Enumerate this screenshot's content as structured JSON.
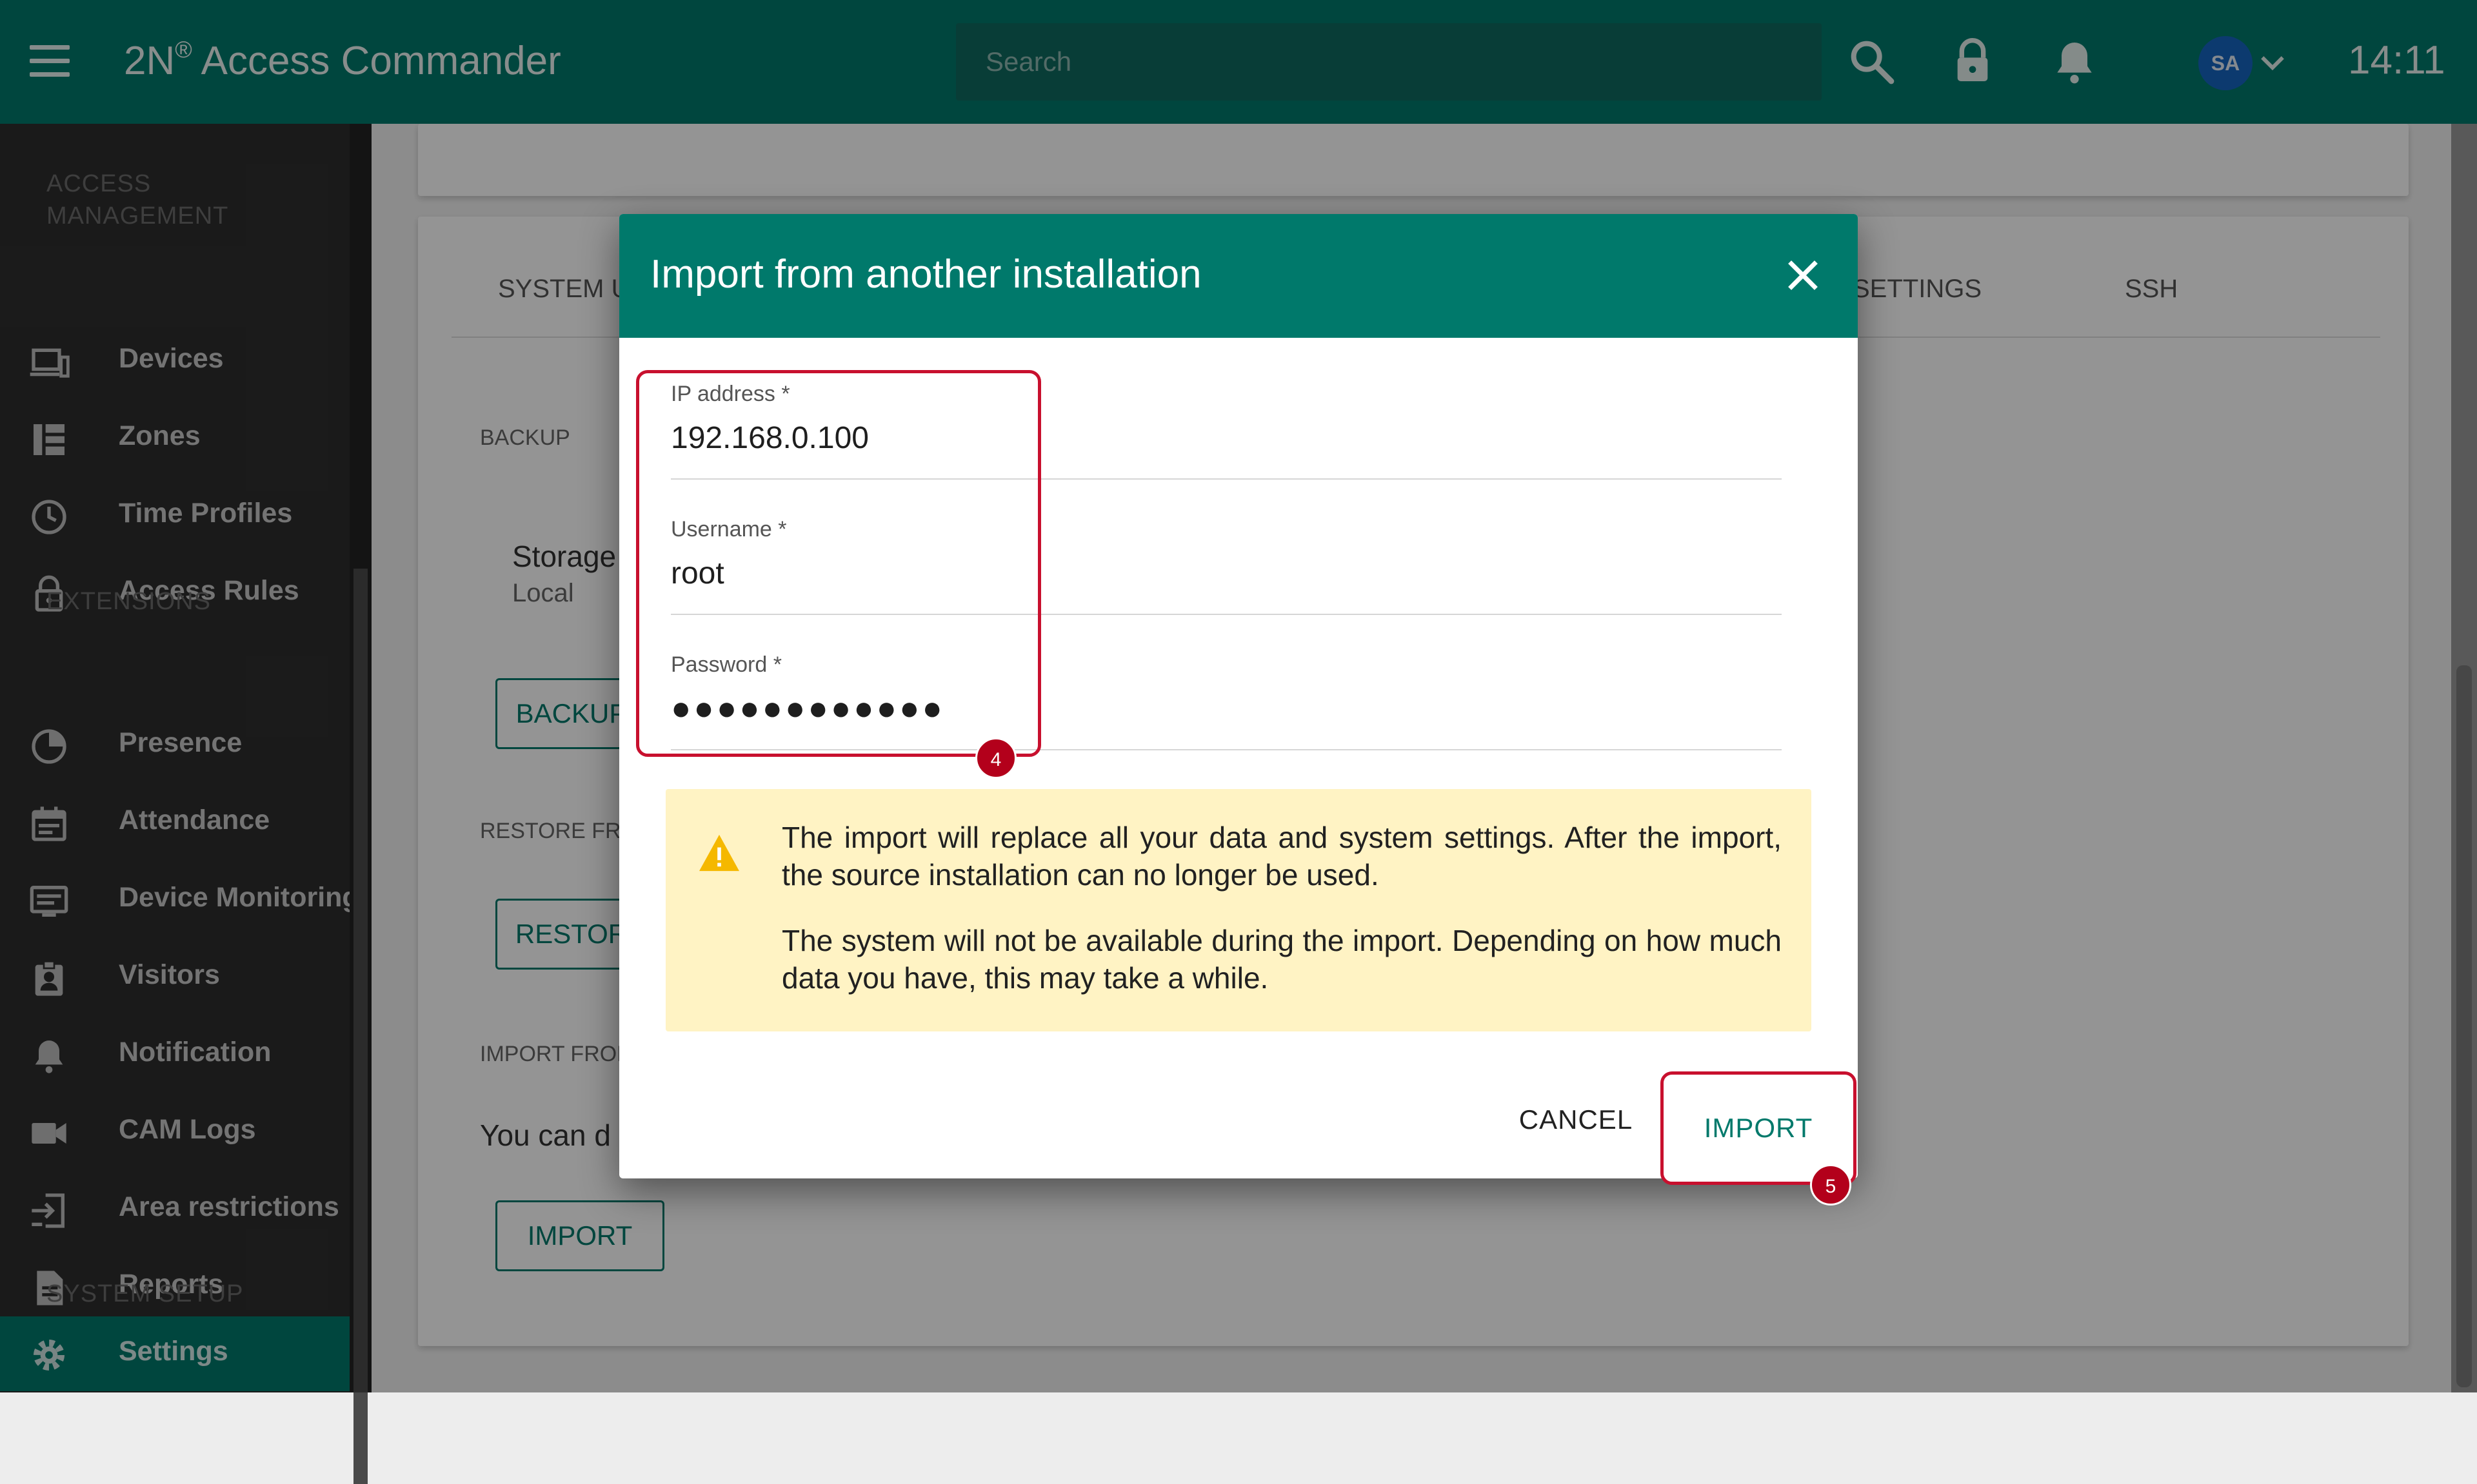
{
  "topbar": {
    "app_title": "2N",
    "app_title_sup": "®",
    "app_title_rest": " Access Commander",
    "search_placeholder": "Search",
    "avatar_initials": "SA",
    "time": "14:11",
    "icons": [
      "menu-icon",
      "search-icon",
      "lock-icon",
      "bell-icon",
      "chevron-down-icon"
    ]
  },
  "sidebar": {
    "sections": {
      "access_management_1": "ACCESS",
      "access_management_2": "MANAGEMENT",
      "extensions": "EXTENSIONS",
      "system_setup": "SYSTEM SETUP"
    },
    "items": [
      {
        "label": "Devices",
        "icon": "devices-icon"
      },
      {
        "label": "Zones",
        "icon": "zones-icon"
      },
      {
        "label": "Time Profiles",
        "icon": "clock-icon"
      },
      {
        "label": "Access Rules",
        "icon": "lock-icon"
      },
      {
        "label": "Presence",
        "icon": "presence-icon"
      },
      {
        "label": "Attendance",
        "icon": "calendar-icon"
      },
      {
        "label": "Device Monitoring",
        "icon": "monitor-icon"
      },
      {
        "label": "Visitors",
        "icon": "visitor-badge-icon"
      },
      {
        "label": "Notification",
        "icon": "bell-icon"
      },
      {
        "label": "CAM Logs",
        "icon": "camera-icon"
      },
      {
        "label": "Area restrictions",
        "icon": "area-icon"
      },
      {
        "label": "Reports",
        "icon": "report-icon"
      },
      {
        "label": "Settings",
        "icon": "gear-icon"
      }
    ]
  },
  "background": {
    "tab_system": "SYSTEM U",
    "tab_settings": "SETTINGS",
    "tab_ssh": "SSH",
    "backup_heading": "BACKUP",
    "storage_label": "Storage",
    "storage_value": "Local",
    "backup_button": "BACKUP",
    "restore_heading": "RESTORE FRO",
    "restore_button": "RESTOR",
    "import_heading": "IMPORT FROM",
    "import_text": "You can d",
    "import_button": "IMPORT"
  },
  "dialog": {
    "title": "Import from another installation",
    "fields": {
      "ip_label": "IP address *",
      "ip_value": "192.168.0.100",
      "username_label": "Username *",
      "username_value": "root",
      "password_label": "Password *",
      "password_value": "●●●●●●●●●●●●"
    },
    "warning": {
      "paragraph1": "The import will replace all your data and system settings. After the import, the source installation can no longer be used.",
      "paragraph2": "The system will not be available during the import. Depending on how much data you have, this may take a while."
    },
    "cancel_label": "CANCEL",
    "import_label": "IMPORT",
    "step_badges": [
      "4",
      "5"
    ]
  },
  "colors": {
    "primary": "#00796b",
    "highlight": "#c8102e",
    "warning_bg": "#fff3c4",
    "sidebar_bg": "#2e2e2e"
  }
}
